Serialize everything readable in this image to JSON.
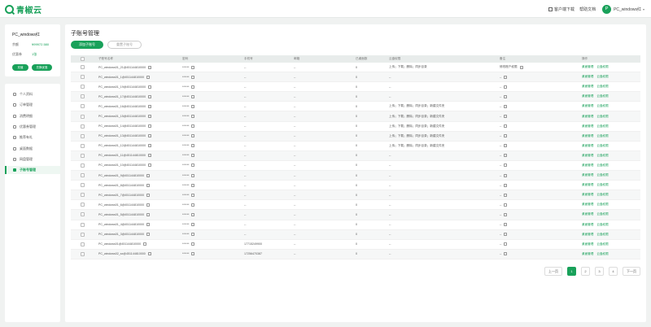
{
  "brand": {
    "name": "青椒云"
  },
  "topbar": {
    "client_download": "客户端下载",
    "help_center": "帮助文档",
    "avatar_letter": "P",
    "username": "PC_windows红"
  },
  "user_card": {
    "name": "PC_windows红",
    "rows": [
      {
        "label": "余额",
        "value": "¥99972.580"
      },
      {
        "label": "优惠券",
        "value": "1张"
      }
    ],
    "recharge_button": "充值",
    "coupon_button": "兑换优惠"
  },
  "menu": [
    {
      "label": "个人资料",
      "icon": "user-icon",
      "active": false
    },
    {
      "label": "订单管理",
      "icon": "order-icon",
      "active": false
    },
    {
      "label": "消费明细",
      "icon": "list-icon",
      "active": false
    },
    {
      "label": "优惠券管理",
      "icon": "coupon-icon",
      "active": false
    },
    {
      "label": "推荐有礼",
      "icon": "gift-icon",
      "active": false
    },
    {
      "label": "桌面数据",
      "icon": "desktop-icon",
      "active": false
    },
    {
      "label": "网盘管理",
      "icon": "disk-icon",
      "active": false
    },
    {
      "label": "子账号管理",
      "icon": "subaccount-icon",
      "active": true
    }
  ],
  "page": {
    "title": "子账号管理",
    "bind_button": "添加子账号",
    "reset_button": "重置子账号"
  },
  "table": {
    "headers": [
      "子账号名称",
      "密码",
      "手机号",
      "邮箱",
      "已桌面数",
      "云盘权限",
      "备注",
      "操作"
    ],
    "ops": [
      "桌面管理",
      "云盘权限"
    ],
    "rows": [
      {
        "name": "PC_windows01_21@451144810000",
        "pwd": "******",
        "phone": "--",
        "email": "--",
        "count": "0",
        "perm": "上传；下载；删除；同步目录",
        "note": "修改账户权限"
      },
      {
        "name": "PC_windows01_1@451144810000",
        "pwd": "******",
        "phone": "--",
        "email": "--",
        "count": "0",
        "perm": "--",
        "note": "--"
      },
      {
        "name": "PC_windows01_19@451144810000",
        "pwd": "******",
        "phone": "--",
        "email": "--",
        "count": "0",
        "perm": "--",
        "note": "--"
      },
      {
        "name": "PC_windows01_17@451144810000",
        "pwd": "******",
        "phone": "--",
        "email": "--",
        "count": "0",
        "perm": "--",
        "note": "--"
      },
      {
        "name": "PC_windows01_16@451144810000",
        "pwd": "******",
        "phone": "--",
        "email": "--",
        "count": "0",
        "perm": "上传；下载；删除；同步目录；新建文件夹",
        "note": "--"
      },
      {
        "name": "PC_windows01_15@451144810000",
        "pwd": "******",
        "phone": "--",
        "email": "--",
        "count": "0",
        "perm": "上传；下载；删除；同步目录；新建文件夹",
        "note": "--"
      },
      {
        "name": "PC_windows01_14@451144810000",
        "pwd": "******",
        "phone": "--",
        "email": "--",
        "count": "0",
        "perm": "上传；下载；删除；同步目录；新建文件夹",
        "note": "--"
      },
      {
        "name": "PC_windows01_13@451144810000",
        "pwd": "******",
        "phone": "--",
        "email": "--",
        "count": "0",
        "perm": "上传；下载；删除；同步目录；新建文件夹",
        "note": "--"
      },
      {
        "name": "PC_windows01_12@451144810000",
        "pwd": "******",
        "phone": "--",
        "email": "--",
        "count": "0",
        "perm": "上传；下载；删除；同步目录；新建文件夹",
        "note": "--"
      },
      {
        "name": "PC_windows01_11@451144810000",
        "pwd": "******",
        "phone": "--",
        "email": "--",
        "count": "0",
        "perm": "--",
        "note": "--"
      },
      {
        "name": "PC_windows01_10@451144810000",
        "pwd": "******",
        "phone": "--",
        "email": "--",
        "count": "0",
        "perm": "--",
        "note": "--"
      },
      {
        "name": "PC_windows01_9@451144810000",
        "pwd": "******",
        "phone": "--",
        "email": "--",
        "count": "0",
        "perm": "--",
        "note": "--"
      },
      {
        "name": "PC_windows01_8@451144810000",
        "pwd": "******",
        "phone": "--",
        "email": "--",
        "count": "0",
        "perm": "--",
        "note": "--"
      },
      {
        "name": "PC_windows01_7@451144810000",
        "pwd": "******",
        "phone": "--",
        "email": "--",
        "count": "0",
        "perm": "--",
        "note": "--"
      },
      {
        "name": "PC_windows01_6@451144810000",
        "pwd": "******",
        "phone": "--",
        "email": "--",
        "count": "0",
        "perm": "--",
        "note": "--"
      },
      {
        "name": "PC_windows01_5@451144810000",
        "pwd": "******",
        "phone": "--",
        "email": "--",
        "count": "0",
        "perm": "--",
        "note": "--"
      },
      {
        "name": "PC_windows01_4@451144810000",
        "pwd": "******",
        "phone": "--",
        "email": "--",
        "count": "0",
        "perm": "--",
        "note": "--"
      },
      {
        "name": "PC_windows01_3@451144810000",
        "pwd": "******",
        "phone": "--",
        "email": "--",
        "count": "0",
        "perm": "--",
        "note": "--"
      },
      {
        "name": "PC_windows01@451144810000",
        "pwd": "******",
        "phone": "17715249900",
        "email": "--",
        "count": "0",
        "perm": "--",
        "note": "--"
      },
      {
        "name": "PC_windows02_sx@451144810000",
        "pwd": "******",
        "phone": "17256470387",
        "email": "--",
        "count": "0",
        "perm": "--",
        "note": "--"
      }
    ]
  },
  "pagination": {
    "prev": "上一页",
    "pages": [
      "1",
      "2",
      "3",
      "4"
    ],
    "current": "1",
    "next": "下一页"
  }
}
